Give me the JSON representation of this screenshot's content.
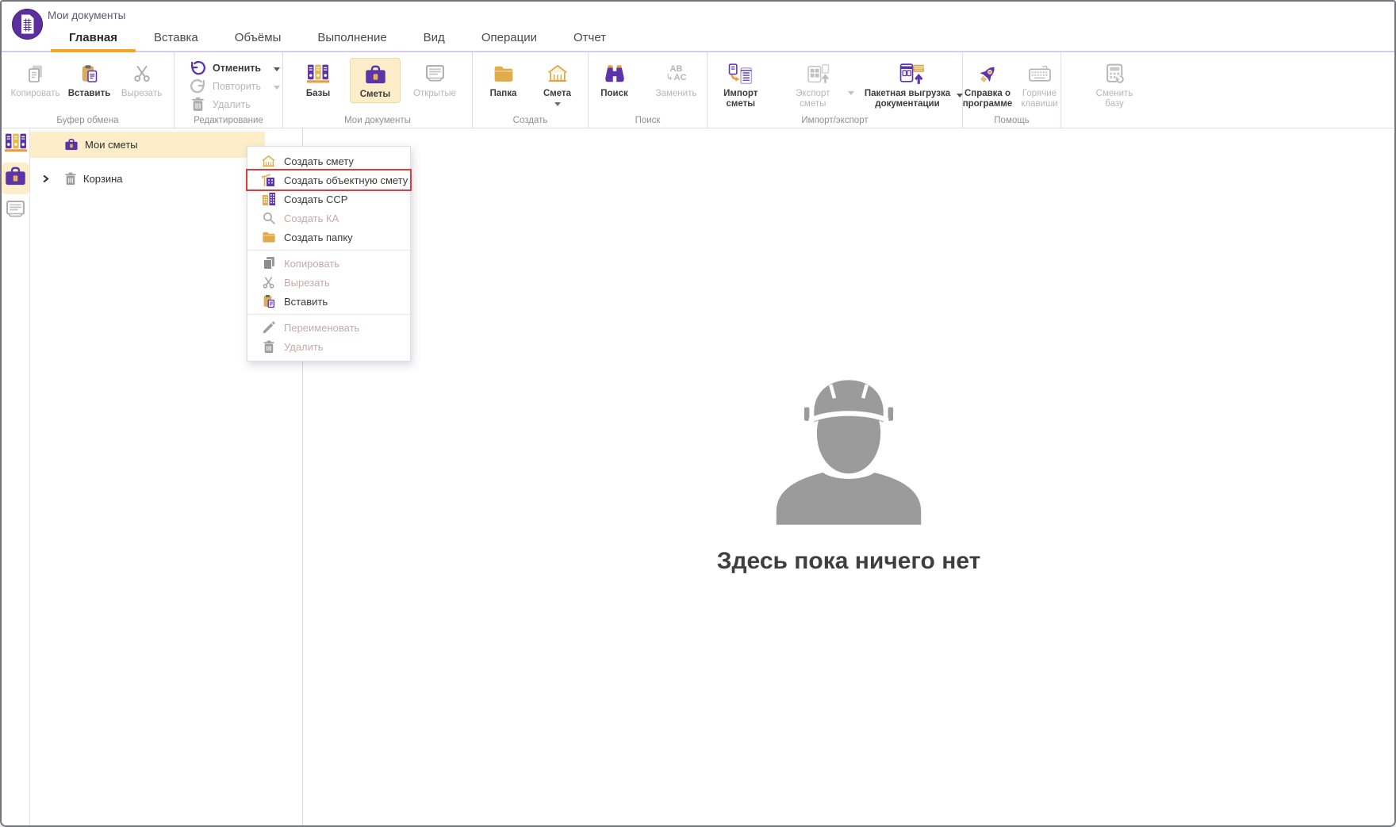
{
  "app": {
    "title": "Мои документы"
  },
  "tabs": [
    {
      "label": "Главная",
      "active": true
    },
    {
      "label": "Вставка",
      "active": false
    },
    {
      "label": "Объёмы",
      "active": false
    },
    {
      "label": "Выполнение",
      "active": false
    },
    {
      "label": "Вид",
      "active": false
    },
    {
      "label": "Операции",
      "active": false
    },
    {
      "label": "Отчет",
      "active": false
    }
  ],
  "ribbon": {
    "replace_glyph": {
      "top": "AB",
      "bottom": "AC"
    },
    "groups": [
      {
        "label": "Буфер обмена",
        "buttons": [
          {
            "label": "Копировать",
            "enabled": false
          },
          {
            "label": "Вставить",
            "enabled": true
          },
          {
            "label": "Вырезать",
            "enabled": false
          }
        ]
      },
      {
        "label": "Редактирование",
        "buttons": [
          {
            "label": "Отменить",
            "enabled": true,
            "dropdown": true
          },
          {
            "label": "Повторить",
            "enabled": false,
            "dropdown": true
          },
          {
            "label": "Удалить",
            "enabled": false
          }
        ]
      },
      {
        "label": "Мои документы",
        "buttons": [
          {
            "label": "Базы",
            "enabled": true
          },
          {
            "label": "Сметы",
            "enabled": true,
            "selected": true
          },
          {
            "label": "Открытые",
            "enabled": false
          }
        ]
      },
      {
        "label": "Создать",
        "buttons": [
          {
            "label": "Папка",
            "enabled": true
          },
          {
            "label": "Смета",
            "enabled": true,
            "dropdown": true
          }
        ]
      },
      {
        "label": "Поиск",
        "buttons": [
          {
            "label": "Поиск",
            "enabled": true
          },
          {
            "label": "Заменить",
            "enabled": false
          }
        ]
      },
      {
        "label": "Импорт/экспорт",
        "buttons": [
          {
            "label": "Импорт сметы",
            "enabled": true
          },
          {
            "label": "Экспорт сметы",
            "enabled": false,
            "dropdown": true
          },
          {
            "label": "Пакетная выгрузка документации",
            "enabled": true,
            "dropdown": true
          }
        ]
      },
      {
        "label": "Помощь",
        "buttons": [
          {
            "label": "Справка о программе",
            "enabled": true
          },
          {
            "label": "Горячие клавиши",
            "enabled": false
          }
        ]
      },
      {
        "label": "",
        "buttons": [
          {
            "label": "Сменить базу",
            "enabled": false
          }
        ]
      }
    ]
  },
  "tree": {
    "items": [
      {
        "label": "Мои сметы",
        "selected": true
      },
      {
        "label": "Корзина",
        "selected": false,
        "expandable": true
      }
    ]
  },
  "context_menu": {
    "items": [
      {
        "label": "Создать смету",
        "enabled": true
      },
      {
        "label": "Создать объектную смету",
        "enabled": true,
        "highlighted": true
      },
      {
        "label": "Создать ССР",
        "enabled": true
      },
      {
        "label": "Создать КА",
        "enabled": false
      },
      {
        "label": "Создать папку",
        "enabled": true
      },
      {
        "label": "Копировать",
        "enabled": false
      },
      {
        "label": "Вырезать",
        "enabled": false
      },
      {
        "label": "Вставить",
        "enabled": true
      },
      {
        "label": "Переименовать",
        "enabled": false
      },
      {
        "label": "Удалить",
        "enabled": false
      }
    ]
  },
  "empty_state": {
    "message": "Здесь пока ничего нет"
  },
  "icons": {
    "logo": "spreadsheet-circle",
    "copy": "document-copy",
    "paste": "clipboard-paste",
    "cut": "scissors",
    "undo": "arrow-undo",
    "redo": "arrow-redo",
    "delete": "trash",
    "bases": "binders-shelf",
    "estimates": "briefcase",
    "opened": "documents",
    "folder": "folder",
    "estimate": "house-columns",
    "search": "binoculars",
    "replace": "letters-ab-ac",
    "import": "import-table",
    "export": "export-grid",
    "batch": "documents-upload",
    "help": "rocket",
    "hotkeys": "keyboard",
    "change_base": "calculator-refresh",
    "create_object_estimate": "building-crane",
    "create_ssr": "city-buildings",
    "create_ka": "magnifier",
    "rename": "pencil",
    "empty_state": "construction-worker",
    "trash_bin": "trash",
    "expand": "chevron-right"
  },
  "colors": {
    "accent_purple": "#5b35a8",
    "accent_orange": "#f5a623",
    "selection_yellow": "#fdeec9",
    "icon_yellow": "#e8b64e",
    "highlight_red": "#e23b3b",
    "disabled_text": "#b6b6b6",
    "menu_disabled_text": "#c7a9a9"
  }
}
